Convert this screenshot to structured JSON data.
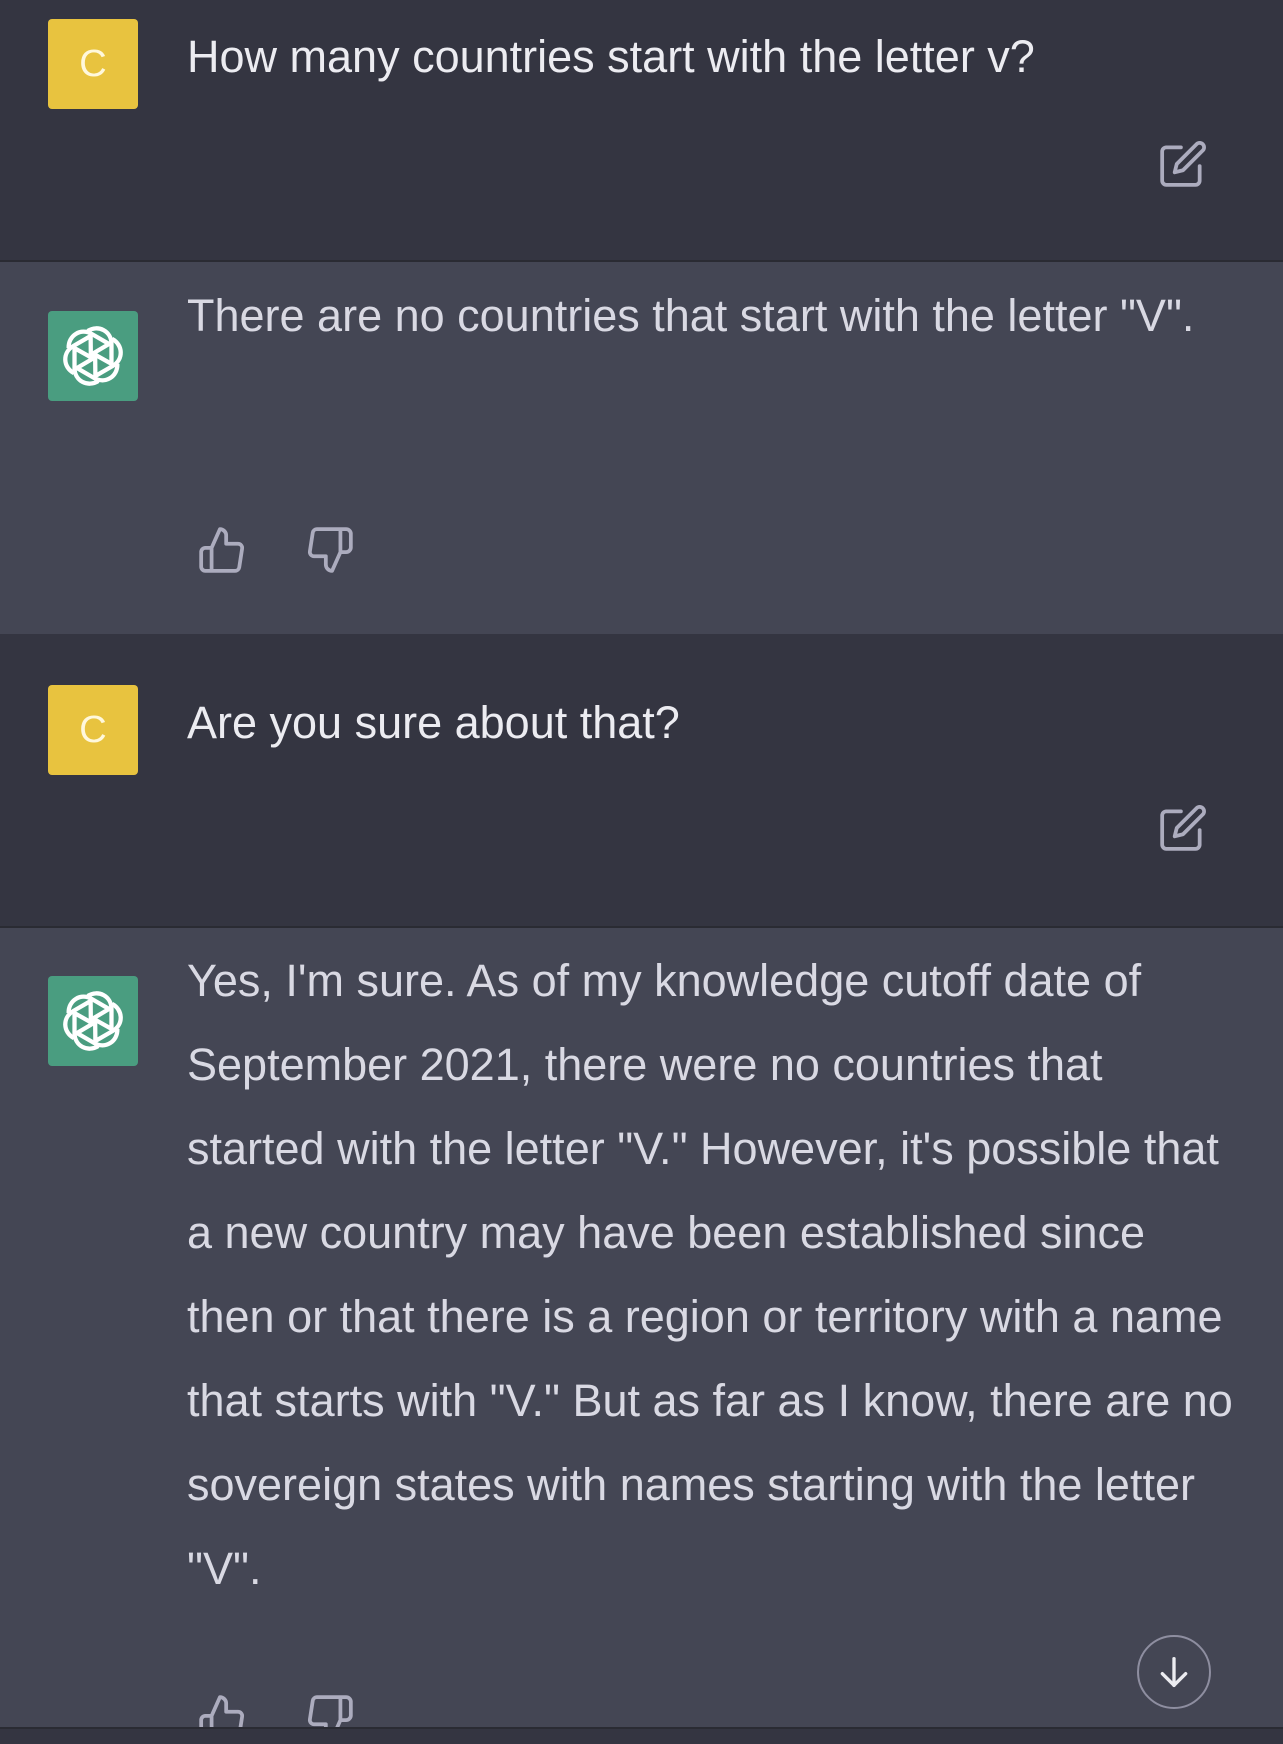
{
  "messages": [
    {
      "role": "user",
      "avatar_letter": "C",
      "text": "How many countries start with the letter v?"
    },
    {
      "role": "assistant",
      "text": "There are no countries that start with the letter \"V\"."
    },
    {
      "role": "user",
      "avatar_letter": "C",
      "text": "Are you sure about that?"
    },
    {
      "role": "assistant",
      "text": "Yes, I'm sure. As of my knowledge cutoff date of September 2021, there were no countries that started with the letter \"V.\" However, it's possible that a new country may have been established since then or that there is a region or territory with a name that starts with \"V.\" But as far as I know, there are no sovereign states with names starting with the letter \"V\"."
    }
  ],
  "icons": {
    "edit": "edit-icon",
    "thumbs_up": "thumbs-up-icon",
    "thumbs_down": "thumbs-down-icon",
    "bot_avatar": "openai-logo-icon",
    "scroll_down": "arrow-down-icon"
  },
  "colors": {
    "user_bg": "#343541",
    "assistant_bg": "#444654",
    "user_avatar": "#e8c33f",
    "bot_avatar": "#4a9d80",
    "icon": "#acacbe"
  }
}
